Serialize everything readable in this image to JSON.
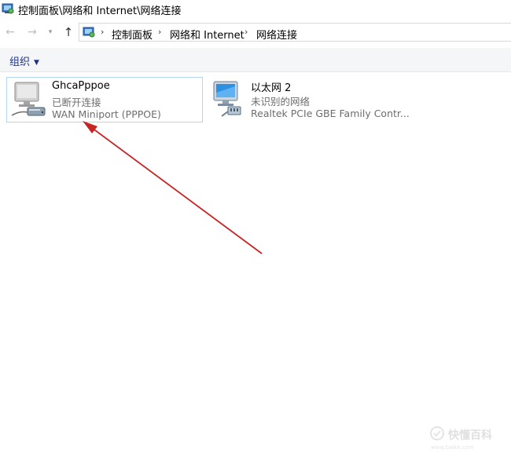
{
  "window": {
    "title": "控制面板\\网络和 Internet\\网络连接"
  },
  "nav": {
    "back_icon": "←",
    "forward_icon": "→",
    "dropdown_icon": "▾",
    "up_icon": "↑"
  },
  "breadcrumb": {
    "separator": "›",
    "items": [
      "控制面板",
      "网络和 Internet",
      "网络连接"
    ]
  },
  "commandbar": {
    "organize_label": "组织",
    "organize_caret": "▼"
  },
  "connections": [
    {
      "name": "GhcaPppoe",
      "status": "已断开连接",
      "device": "WAN Miniport (PPPOE)",
      "icon": "broadband-connection-icon",
      "selected": true
    },
    {
      "name": "以太网 2",
      "status": "未识别的网络",
      "device": "Realtek PCIe GBE Family Contr...",
      "icon": "ethernet-connection-icon",
      "selected": false
    }
  ],
  "annotation": {
    "arrow_color": "#c82424"
  },
  "watermark": {
    "text": "快懂百科",
    "sub": "www.baike.com"
  },
  "colors": {
    "selection_border": "#b3d6f2",
    "link_blue": "#1e3287",
    "secondary_text": "#6d6d6d"
  }
}
